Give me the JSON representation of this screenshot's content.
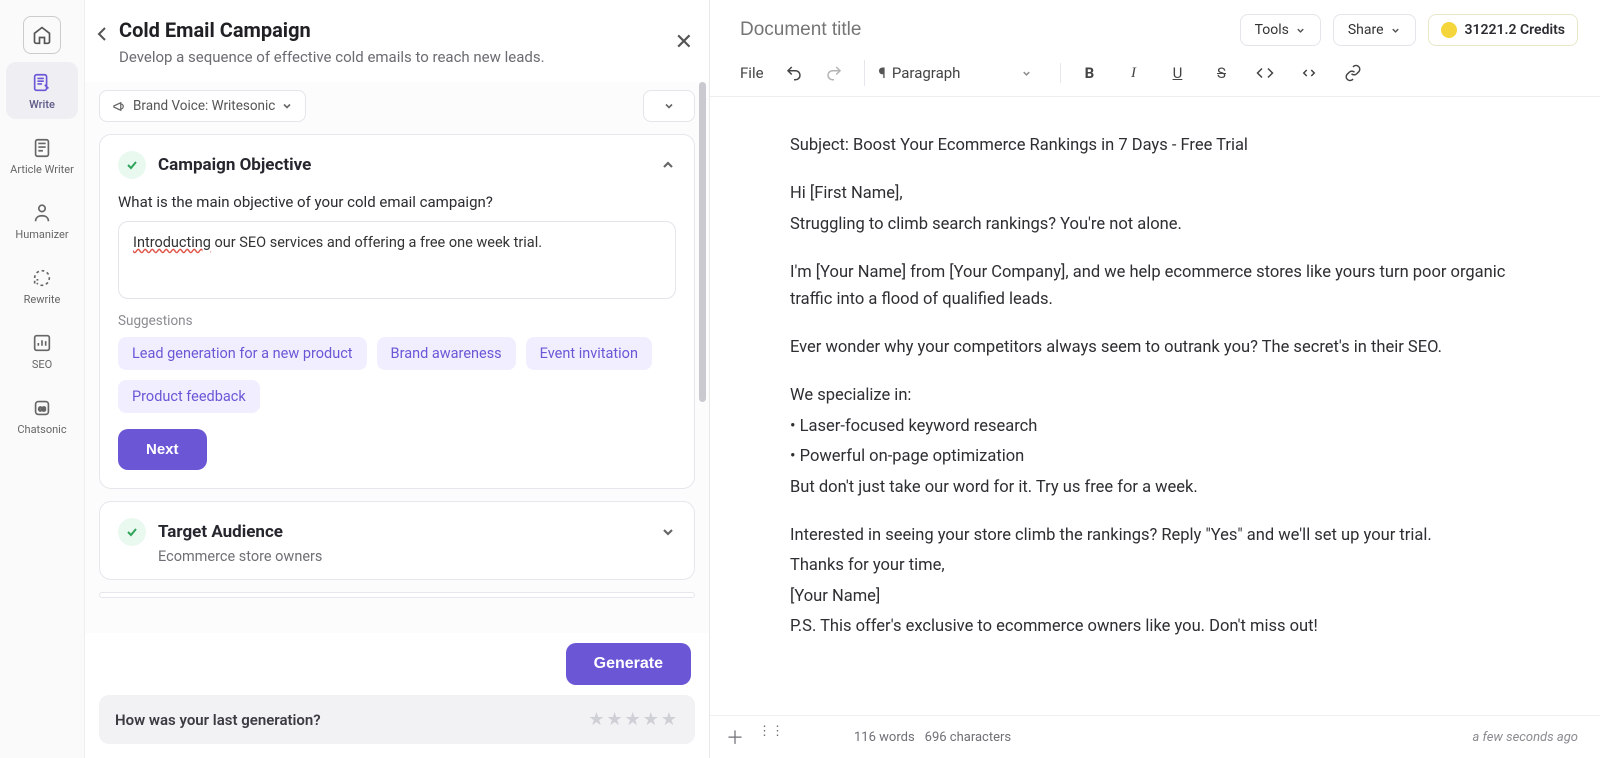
{
  "sidebar": {
    "items": [
      {
        "label": "Write"
      },
      {
        "label": "Article Writer"
      },
      {
        "label": "Humanizer"
      },
      {
        "label": "Rewrite"
      },
      {
        "label": "SEO"
      },
      {
        "label": "Chatsonic"
      }
    ]
  },
  "form": {
    "title": "Cold Email Campaign",
    "subtitle": "Develop a sequence of effective cold emails to reach new leads.",
    "brand_voice_label": "Brand Voice: Writesonic",
    "objective": {
      "section_title": "Campaign Objective",
      "question": "What is the main objective of your cold email campaign?",
      "value_pre": "Introducting",
      "value_post": " our SEO services and offering a free one week trial.",
      "suggestions_label": "Suggestions",
      "suggestions": [
        "Lead generation for a new product",
        "Brand awareness",
        "Event invitation",
        "Product feedback"
      ],
      "next_label": "Next"
    },
    "audience": {
      "section_title": "Target Audience",
      "summary": "Ecommerce store owners"
    },
    "generate_label": "Generate",
    "feedback_question": "How was your last generation?"
  },
  "editor": {
    "doc_title_placeholder": "Document title",
    "tools_label": "Tools",
    "share_label": "Share",
    "credits_label": "31221.2 Credits",
    "file_label": "File",
    "paragraph_label": "Paragraph",
    "body": {
      "l0": "Subject: Boost Your Ecommerce Rankings in 7 Days - Free Trial",
      "l1": "Hi [First Name],",
      "l2": "Struggling to climb search rankings? You're not alone.",
      "l3": "I'm [Your Name] from [Your Company], and we help ecommerce stores like yours turn poor organic traffic into a flood of qualified leads.",
      "l4": "Ever wonder why your competitors always seem to outrank you? The secret's in their SEO.",
      "l5": "We specialize in:",
      "l6": "• Laser-focused keyword research",
      "l7": "• Powerful on-page optimization",
      "l8": "But don't just take our word for it. Try us free for a week.",
      "l9": "Interested in seeing your store climb the rankings? Reply \"Yes\" and we'll set up your trial.",
      "l10": "Thanks for your time,",
      "l11": "[Your Name]",
      "l12": "P.S. This offer's exclusive to ecommerce owners like you. Don't miss out!"
    },
    "status": {
      "words": "116 words",
      "chars": "696 characters",
      "ago": "a few seconds ago"
    }
  }
}
